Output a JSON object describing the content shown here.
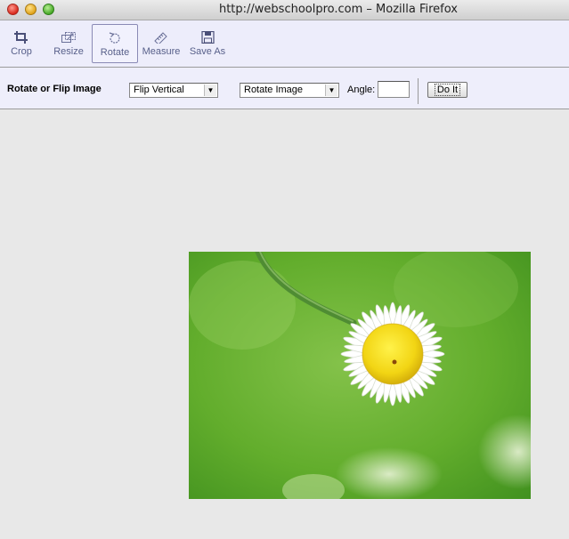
{
  "window": {
    "title": "http://webschoolpro.com – Mozilla Firefox"
  },
  "toolbar": {
    "tools": [
      {
        "label": "Crop",
        "icon": "crop-icon"
      },
      {
        "label": "Resize",
        "icon": "resize-icon"
      },
      {
        "label": "Rotate",
        "icon": "rotate-icon",
        "active": true
      },
      {
        "label": "Measure",
        "icon": "ruler-icon"
      },
      {
        "label": "Save As",
        "icon": "floppy-disk-icon"
      }
    ]
  },
  "options": {
    "title": "Rotate or Flip Image",
    "flip_select": {
      "value": "Flip Vertical"
    },
    "rotate_select": {
      "value": "Rotate Image"
    },
    "angle_label": "Angle:",
    "angle_value": "",
    "do_it_label": "Do It"
  },
  "canvas": {
    "image_subject": "white daisy flower on green background"
  },
  "colors": {
    "toolbar_bg": "#ededfb",
    "tool_text": "#58608a",
    "canvas_bg": "#e8e8e8"
  }
}
